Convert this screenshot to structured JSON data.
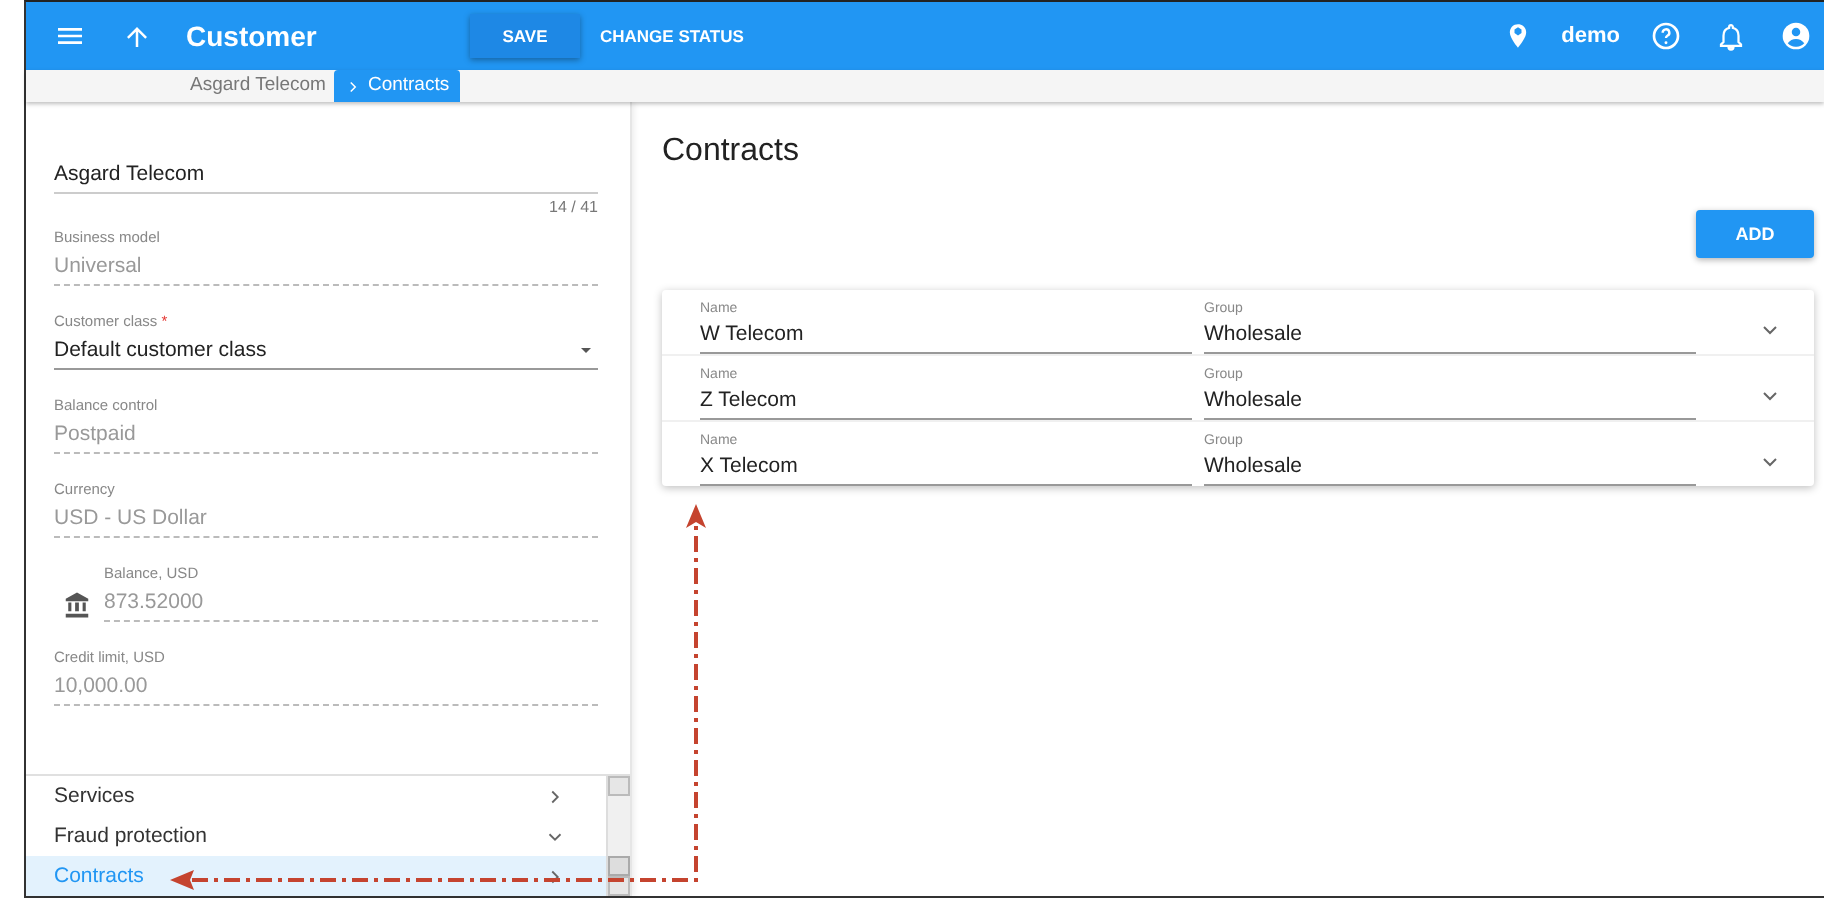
{
  "header": {
    "title": "Customer",
    "buttons": [
      {
        "label": "SAVE",
        "kind": "raised"
      },
      {
        "label": "CHANGE STATUS",
        "kind": "flat"
      }
    ],
    "user": "demo"
  },
  "breadcrumbs": [
    {
      "label": "Asgard Telecom",
      "selected": false
    },
    {
      "label": "Contracts",
      "selected": true
    }
  ],
  "form": {
    "name": "Asgard Telecom",
    "counter": "14 / 41",
    "fields": [
      {
        "kind": "readonly",
        "label": "Business model",
        "value": "Universal"
      },
      {
        "kind": "select",
        "label": "Customer class",
        "required_mark": "*",
        "value": "Default customer class"
      },
      {
        "kind": "readonly",
        "label": "Balance control",
        "value": "Postpaid"
      },
      {
        "kind": "readonly",
        "label": "Currency",
        "value": "USD - US Dollar"
      },
      {
        "kind": "icon",
        "label": "Balance, USD",
        "value": "873.52000"
      },
      {
        "kind": "readonly",
        "label": "Credit limit, USD",
        "value": "10,000.00"
      }
    ]
  },
  "sections": [
    {
      "label": "Services",
      "expanded": false,
      "selected": false
    },
    {
      "label": "Fraud protection",
      "expanded": true,
      "selected": false
    },
    {
      "label": "Contracts",
      "expanded": false,
      "selected": true
    }
  ],
  "contracts": {
    "title": "Contracts",
    "add": "ADD",
    "rows": [
      {
        "name_label": "Name",
        "name": "W Telecom",
        "group_label": "Group",
        "group": "Wholesale"
      },
      {
        "name_label": "Name",
        "name": "Z Telecom",
        "group_label": "Group",
        "group": "Wholesale"
      },
      {
        "name_label": "Name",
        "name": "X Telecom",
        "group_label": "Group",
        "group": "Wholesale"
      }
    ]
  }
}
